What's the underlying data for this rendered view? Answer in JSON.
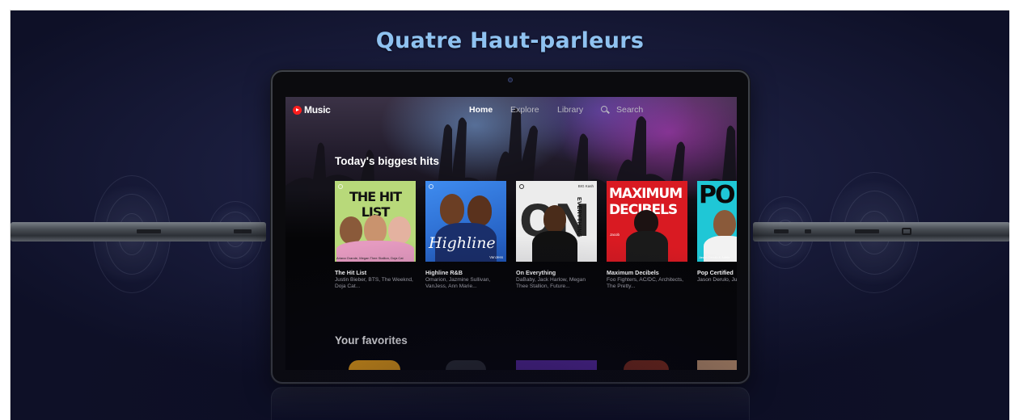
{
  "headline": "Quatre Haut-parleurs",
  "app": {
    "logo_text": "Music",
    "nav": {
      "home": "Home",
      "explore": "Explore",
      "library": "Library",
      "search": "Search"
    }
  },
  "shelves": {
    "biggest_hits": "Today's biggest hits",
    "favorites": "Your favorites"
  },
  "cards": [
    {
      "title": "The Hit List",
      "subtitle": "Justin Bieber, BTS, The Weeknd, Doja Cat...",
      "art_text": "THE HIT LIST",
      "art_caption": "Ariana Grande, Megan Thee Stallion, Doja Cat"
    },
    {
      "title": "Highline R&B",
      "subtitle": "Omarion, Jazmine Sullivan, VanJess, Ann Marie...",
      "art_text": "Highline",
      "art_caption": "VanJess"
    },
    {
      "title": "On Everything",
      "subtitle": "DaBaby, Jack Harlow, Megan Thee Stallion, Future...",
      "art_text": "ON",
      "art_side": "EVERYTHING",
      "art_caption": "BIG Kash"
    },
    {
      "title": "Maximum Decibels",
      "subtitle": "Foo Fighters, AC/DC, Architects, The Pretty...",
      "art_text": "MAXIMUM DECIBELS",
      "art_caption": "Jacob"
    },
    {
      "title": "Pop Certified",
      "subtitle": "Jason Derulo, Justin Bieber, I",
      "art_text": "PO",
      "art_caption": "Jason Derulo & Adele"
    }
  ],
  "colors": {
    "headline": "#8fc2f0",
    "brand_red": "#ff1e1e",
    "hitlist_green": "#b8d97a",
    "highline_blue": "#2a6fd6",
    "decibels_red": "#e01b22",
    "pop_cyan": "#1fc7d6"
  }
}
